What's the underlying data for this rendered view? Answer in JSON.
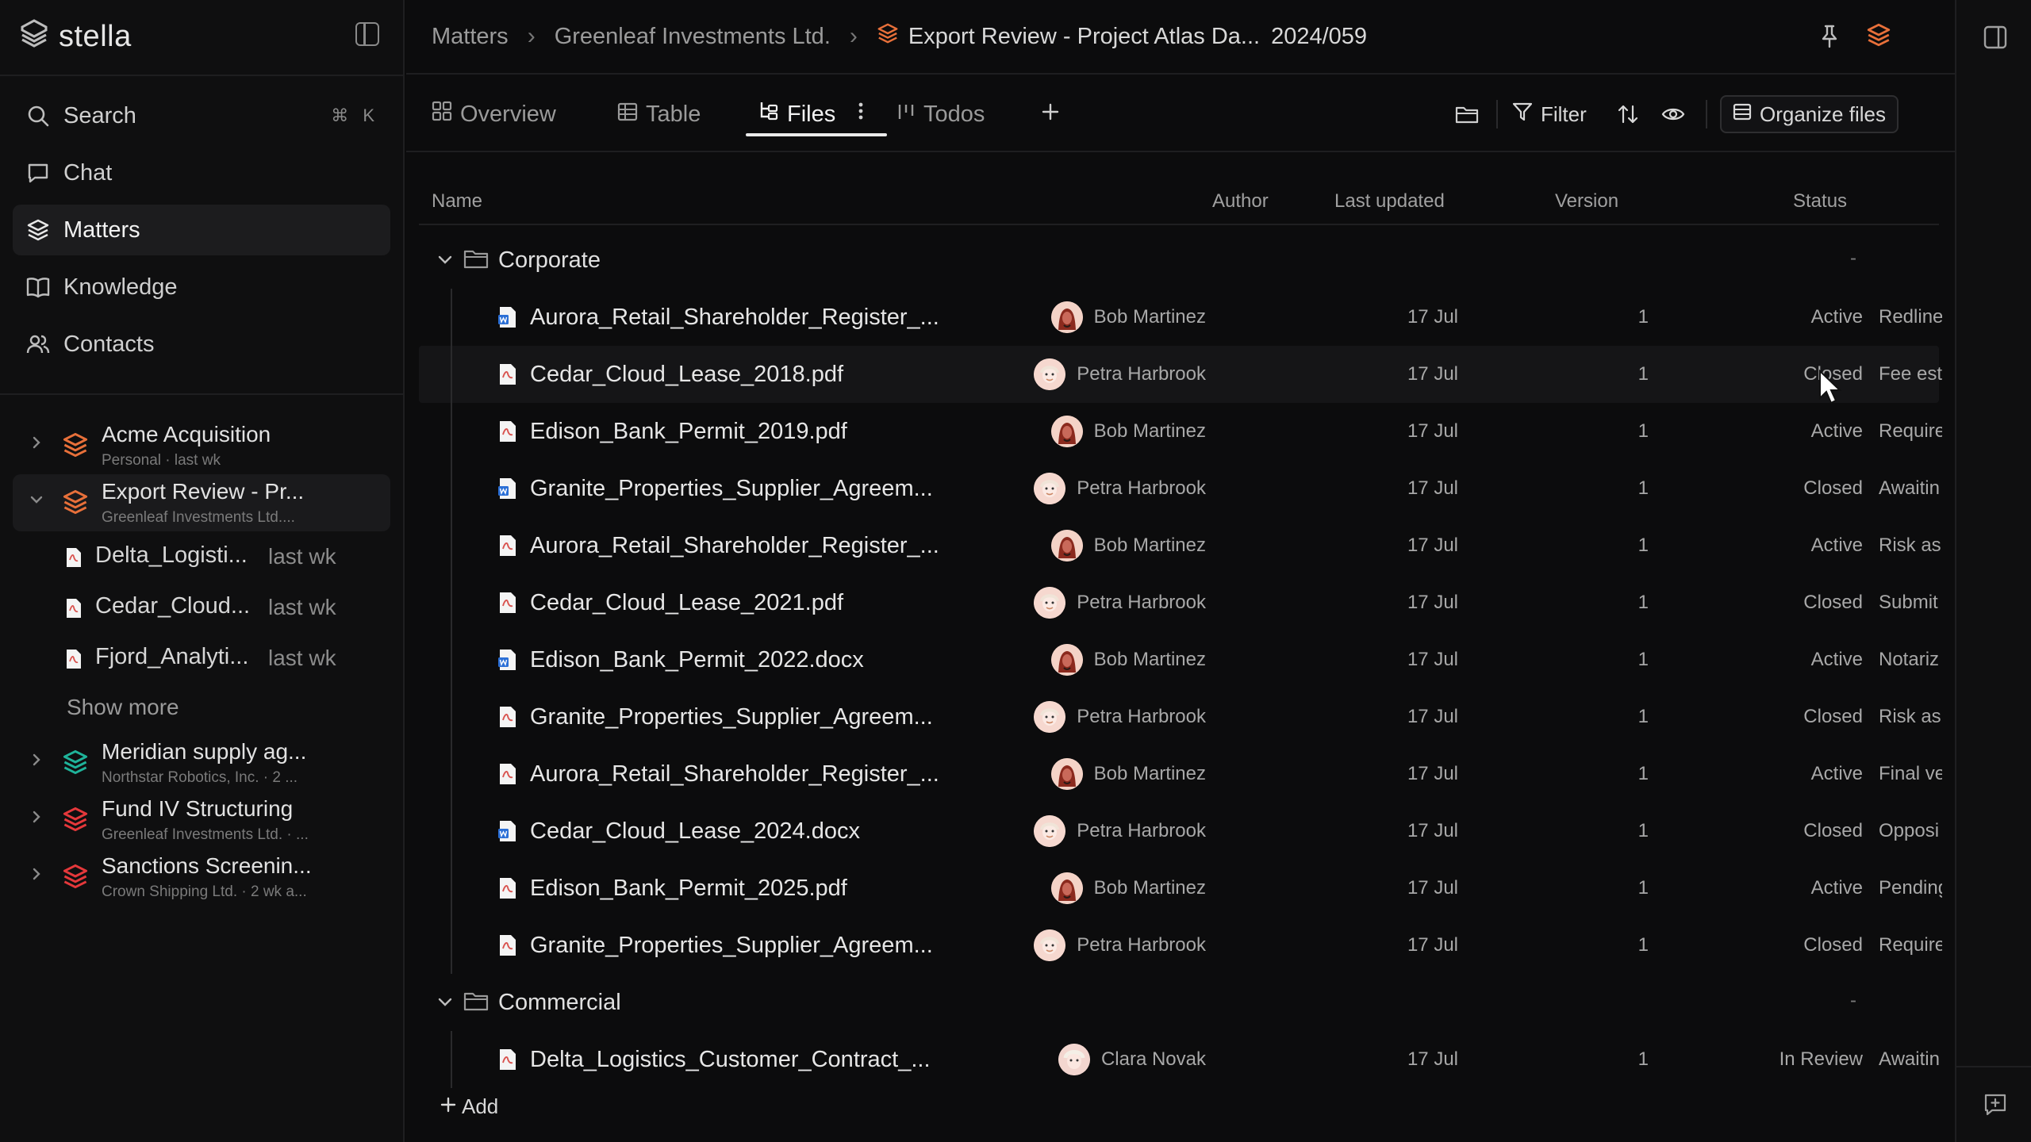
{
  "brand": {
    "name": "stella"
  },
  "nav": {
    "items": [
      {
        "label": "Search",
        "shortcut": "⌘ K",
        "icon": "search-icon"
      },
      {
        "label": "Chat",
        "icon": "chat-icon"
      },
      {
        "label": "Matters",
        "icon": "stack-icon",
        "active": true
      },
      {
        "label": "Knowledge",
        "icon": "book-icon"
      },
      {
        "label": "Contacts",
        "icon": "people-icon"
      }
    ]
  },
  "matters": [
    {
      "title": "Acme Acquisition",
      "subtitle": "Personal · last wk",
      "color": "#e8703a"
    },
    {
      "title": "Export Review - Pr...",
      "subtitle": "Greenleaf Investments Ltd....",
      "color": "#e8703a",
      "expanded": true,
      "files": [
        {
          "name": "Delta_Logisti...",
          "time": "last wk"
        },
        {
          "name": "Cedar_Cloud...",
          "time": "last wk"
        },
        {
          "name": "Fjord_Analyti...",
          "time": "last wk"
        }
      ],
      "show_more": "Show more"
    },
    {
      "title": "Meridian supply ag...",
      "subtitle": "Northstar Robotics, Inc. · 2 ...",
      "color": "#1fb39a"
    },
    {
      "title": "Fund IV Structuring",
      "subtitle": "Greenleaf Investments Ltd. · ...",
      "color": "#e5383b"
    },
    {
      "title": "Sanctions Screenin...",
      "subtitle": "Crown Shipping Ltd. · 2 wk a...",
      "color": "#e5383b"
    }
  ],
  "breadcrumb": {
    "root": "Matters",
    "client": "Greenleaf Investments Ltd.",
    "matter": "Export Review - Project Atlas Da...",
    "matter_id": "2024/059"
  },
  "tabs": {
    "overview": "Overview",
    "table": "Table",
    "files": "Files",
    "todos": "Todos"
  },
  "toolbar": {
    "filter": "Filter",
    "organize": "Organize files"
  },
  "table": {
    "headers": {
      "name": "Name",
      "author": "Author",
      "updated": "Last updated",
      "version": "Version",
      "status": "Status"
    },
    "groups": [
      {
        "name": "Corporate",
        "dash": "-",
        "rows": [
          {
            "name": "Aurora_Retail_Shareholder_Register_...",
            "type": "word",
            "author": "Bob Martinez",
            "updated": "17 Jul",
            "version": "1",
            "status": "Active",
            "note": "Redline"
          },
          {
            "name": "Cedar_Cloud_Lease_2018.pdf",
            "type": "pdf",
            "author": "Petra Harbrook",
            "updated": "17 Jul",
            "version": "1",
            "status": "Closed",
            "note": "Fee est"
          },
          {
            "name": "Edison_Bank_Permit_2019.pdf",
            "type": "pdf",
            "author": "Bob Martinez",
            "updated": "17 Jul",
            "version": "1",
            "status": "Active",
            "note": "Require"
          },
          {
            "name": "Granite_Properties_Supplier_Agreem...",
            "type": "word",
            "author": "Petra Harbrook",
            "updated": "17 Jul",
            "version": "1",
            "status": "Closed",
            "note": "Awaitin"
          },
          {
            "name": "Aurora_Retail_Shareholder_Register_...",
            "type": "pdf",
            "author": "Bob Martinez",
            "updated": "17 Jul",
            "version": "1",
            "status": "Active",
            "note": "Risk as:"
          },
          {
            "name": "Cedar_Cloud_Lease_2021.pdf",
            "type": "pdf",
            "author": "Petra Harbrook",
            "updated": "17 Jul",
            "version": "1",
            "status": "Closed",
            "note": "Submit"
          },
          {
            "name": "Edison_Bank_Permit_2022.docx",
            "type": "word",
            "author": "Bob Martinez",
            "updated": "17 Jul",
            "version": "1",
            "status": "Active",
            "note": "Notariz"
          },
          {
            "name": "Granite_Properties_Supplier_Agreem...",
            "type": "pdf",
            "author": "Petra Harbrook",
            "updated": "17 Jul",
            "version": "1",
            "status": "Closed",
            "note": "Risk as:"
          },
          {
            "name": "Aurora_Retail_Shareholder_Register_...",
            "type": "pdf",
            "author": "Bob Martinez",
            "updated": "17 Jul",
            "version": "1",
            "status": "Active",
            "note": "Final ve"
          },
          {
            "name": "Cedar_Cloud_Lease_2024.docx",
            "type": "word",
            "author": "Petra Harbrook",
            "updated": "17 Jul",
            "version": "1",
            "status": "Closed",
            "note": "Opposi"
          },
          {
            "name": "Edison_Bank_Permit_2025.pdf",
            "type": "pdf",
            "author": "Bob Martinez",
            "updated": "17 Jul",
            "version": "1",
            "status": "Active",
            "note": "Pending"
          },
          {
            "name": "Granite_Properties_Supplier_Agreem...",
            "type": "pdf",
            "author": "Petra Harbrook",
            "updated": "17 Jul",
            "version": "1",
            "status": "Closed",
            "note": "Require"
          }
        ]
      },
      {
        "name": "Commercial",
        "dash": "-",
        "rows": [
          {
            "name": "Delta_Logistics_Customer_Contract_...",
            "type": "pdf",
            "author": "Clara Novak",
            "updated": "17 Jul",
            "version": "1",
            "status": "In Review",
            "note": "Awaitin"
          }
        ]
      }
    ],
    "add_label": "Add"
  },
  "colors": {
    "accent_orange": "#e8703a",
    "accent_teal": "#1fb39a",
    "accent_red": "#e5383b",
    "word_blue": "#2b6fd6",
    "pdf_red": "#d9534f"
  }
}
